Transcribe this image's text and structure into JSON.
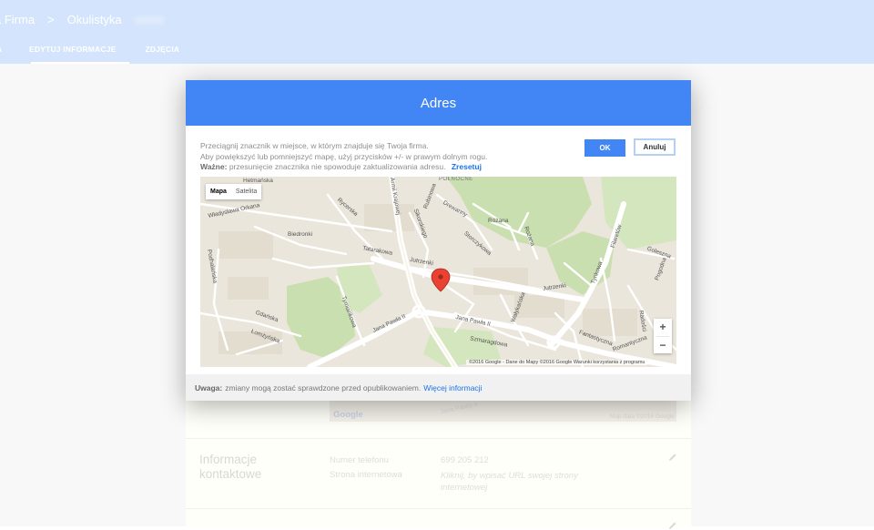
{
  "breadcrumb": {
    "business": "a Firma",
    "separator": ">",
    "category": "Okulistyka",
    "blurred_suffix": "xxxxx"
  },
  "tabs": [
    {
      "label": "A"
    },
    {
      "label": "EDYTUJ INFORMACJE"
    },
    {
      "label": "ZDJĘCIA"
    }
  ],
  "background": {
    "map_google": "Google",
    "map_data": "Map data ©2016 Google",
    "map_road": "Jana Pawła II",
    "contact_title": "Informacje kontaktowe",
    "phone_label": "Numer telefonu",
    "phone_value": "699 205 212",
    "website_label": "Strona internetowa",
    "website_value": "Kliknij, by wpisać URL swojej strony internetowej"
  },
  "dialog": {
    "title": "Adres",
    "instr_line1": "Przeciągnij znacznik w miejsce, w którym znajduje się Twoja firma.",
    "instr_line2": "Aby powiększyć lub pomniejszyć mapę, użyj przycisków +/- w prawym dolnym rogu.",
    "instr_bold": "Ważne:",
    "instr_line3": "przesunięcie znacznika nie spowoduje zaktualizowania adresu.",
    "reset_link": "Zresetuj",
    "ok_label": "OK",
    "cancel_label": "Anuluj",
    "map_type_map": "Mapa",
    "map_type_satellite": "Satelita",
    "zoom_in": "+",
    "zoom_out": "−",
    "attribution": "©2016 Google - Dane do Mapy ©2016 Google    Warunki korzystania z programu",
    "footer_bold": "Uwaga:",
    "footer_text": "zmiany mogą zostać sprawdzone przed opublikowaniem.",
    "footer_link": "Więcej informacji"
  },
  "map_labels": {
    "l1": "Hetmańska",
    "l2": "POŁNOCNE",
    "l3": "Armii Krajowej",
    "l4": "Rycerska",
    "l5": "Władysława Orkana",
    "l6": "Rubinowa",
    "l7": "Sikorskiego",
    "l8": "Drewanny",
    "l9": "Różana",
    "l10": "Storczykowa",
    "l11": "Biedronki",
    "l12": "Rożana",
    "l13": "Tatarakowa",
    "l14": "Podhalańska",
    "l15": "Jutrzenki",
    "l16": "Jutrzenki",
    "l17": "Filaretów",
    "l18": "Goleszna",
    "l19": "Tymiankowa",
    "l20": "Gdańska",
    "l21": "Łomżyńska",
    "l22": "Jana Pawła II",
    "l23": "Jana Pawła II",
    "l24": "Szmaragdowa",
    "l25": "Wałykańska",
    "l26": "Radości",
    "l27": "Fantastyczna",
    "l28": "Romantyczna",
    "l29": "Tynkowa",
    "l30": "Pogodna"
  },
  "colors": {
    "header": "#4285f4",
    "topbar": "#d2e3fc",
    "link": "#1a73e8",
    "marker": "#e94235"
  }
}
